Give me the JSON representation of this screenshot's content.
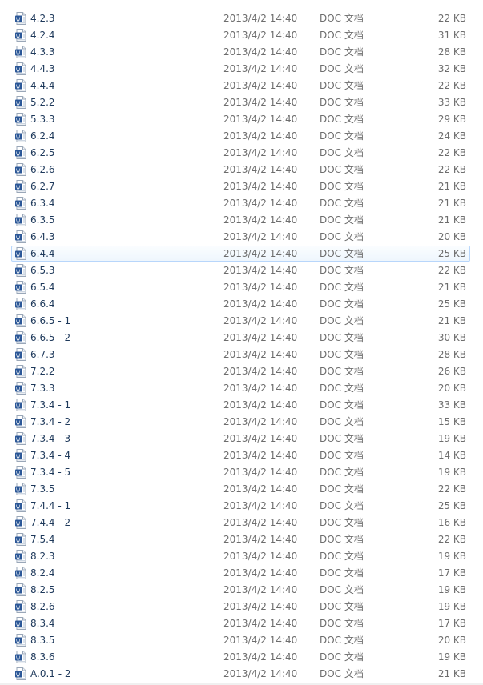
{
  "list": {
    "selected_index": 14,
    "icon": "word-document-icon",
    "colors": {
      "name_text": "#1e395b",
      "meta_text": "#6d6d6d",
      "selection_border": "#b8d6fb",
      "icon_blue": "#2b5797"
    },
    "rows": [
      {
        "name": "4.2.3",
        "date": "2013/4/2 14:40",
        "type": "DOC 文档",
        "size": "22 KB"
      },
      {
        "name": "4.2.4",
        "date": "2013/4/2 14:40",
        "type": "DOC 文档",
        "size": "31 KB"
      },
      {
        "name": "4.3.3",
        "date": "2013/4/2 14:40",
        "type": "DOC 文档",
        "size": "28 KB"
      },
      {
        "name": "4.4.3",
        "date": "2013/4/2 14:40",
        "type": "DOC 文档",
        "size": "32 KB"
      },
      {
        "name": "4.4.4",
        "date": "2013/4/2 14:40",
        "type": "DOC 文档",
        "size": "22 KB"
      },
      {
        "name": "5.2.2",
        "date": "2013/4/2 14:40",
        "type": "DOC 文档",
        "size": "33 KB"
      },
      {
        "name": "5.3.3",
        "date": "2013/4/2 14:40",
        "type": "DOC 文档",
        "size": "29 KB"
      },
      {
        "name": "6.2.4",
        "date": "2013/4/2 14:40",
        "type": "DOC 文档",
        "size": "24 KB"
      },
      {
        "name": "6.2.5",
        "date": "2013/4/2 14:40",
        "type": "DOC 文档",
        "size": "22 KB"
      },
      {
        "name": "6.2.6",
        "date": "2013/4/2 14:40",
        "type": "DOC 文档",
        "size": "22 KB"
      },
      {
        "name": "6.2.7",
        "date": "2013/4/2 14:40",
        "type": "DOC 文档",
        "size": "21 KB"
      },
      {
        "name": "6.3.4",
        "date": "2013/4/2 14:40",
        "type": "DOC 文档",
        "size": "21 KB"
      },
      {
        "name": "6.3.5",
        "date": "2013/4/2 14:40",
        "type": "DOC 文档",
        "size": "21 KB"
      },
      {
        "name": "6.4.3",
        "date": "2013/4/2 14:40",
        "type": "DOC 文档",
        "size": "20 KB"
      },
      {
        "name": "6.4.4",
        "date": "2013/4/2 14:40",
        "type": "DOC 文档",
        "size": "25 KB"
      },
      {
        "name": "6.5.3",
        "date": "2013/4/2 14:40",
        "type": "DOC 文档",
        "size": "22 KB"
      },
      {
        "name": "6.5.4",
        "date": "2013/4/2 14:40",
        "type": "DOC 文档",
        "size": "21 KB"
      },
      {
        "name": "6.6.4",
        "date": "2013/4/2 14:40",
        "type": "DOC 文档",
        "size": "25 KB"
      },
      {
        "name": "6.6.5 - 1",
        "date": "2013/4/2 14:40",
        "type": "DOC 文档",
        "size": "21 KB"
      },
      {
        "name": "6.6.5 - 2",
        "date": "2013/4/2 14:40",
        "type": "DOC 文档",
        "size": "30 KB"
      },
      {
        "name": "6.7.3",
        "date": "2013/4/2 14:40",
        "type": "DOC 文档",
        "size": "28 KB"
      },
      {
        "name": "7.2.2",
        "date": "2013/4/2 14:40",
        "type": "DOC 文档",
        "size": "26 KB"
      },
      {
        "name": "7.3.3",
        "date": "2013/4/2 14:40",
        "type": "DOC 文档",
        "size": "20 KB"
      },
      {
        "name": "7.3.4 - 1",
        "date": "2013/4/2 14:40",
        "type": "DOC 文档",
        "size": "33 KB"
      },
      {
        "name": "7.3.4 - 2",
        "date": "2013/4/2 14:40",
        "type": "DOC 文档",
        "size": "15 KB"
      },
      {
        "name": "7.3.4 - 3",
        "date": "2013/4/2 14:40",
        "type": "DOC 文档",
        "size": "19 KB"
      },
      {
        "name": "7.3.4 - 4",
        "date": "2013/4/2 14:40",
        "type": "DOC 文档",
        "size": "14 KB"
      },
      {
        "name": "7.3.4 - 5",
        "date": "2013/4/2 14:40",
        "type": "DOC 文档",
        "size": "19 KB"
      },
      {
        "name": "7.3.5",
        "date": "2013/4/2 14:40",
        "type": "DOC 文档",
        "size": "22 KB"
      },
      {
        "name": "7.4.4 - 1",
        "date": "2013/4/2 14:40",
        "type": "DOC 文档",
        "size": "25 KB"
      },
      {
        "name": "7.4.4 - 2",
        "date": "2013/4/2 14:40",
        "type": "DOC 文档",
        "size": "16 KB"
      },
      {
        "name": "7.5.4",
        "date": "2013/4/2 14:40",
        "type": "DOC 文档",
        "size": "22 KB"
      },
      {
        "name": "8.2.3",
        "date": "2013/4/2 14:40",
        "type": "DOC 文档",
        "size": "19 KB"
      },
      {
        "name": "8.2.4",
        "date": "2013/4/2 14:40",
        "type": "DOC 文档",
        "size": "17 KB"
      },
      {
        "name": "8.2.5",
        "date": "2013/4/2 14:40",
        "type": "DOC 文档",
        "size": "19 KB"
      },
      {
        "name": "8.2.6",
        "date": "2013/4/2 14:40",
        "type": "DOC 文档",
        "size": "19 KB"
      },
      {
        "name": "8.3.4",
        "date": "2013/4/2 14:40",
        "type": "DOC 文档",
        "size": "17 KB"
      },
      {
        "name": "8.3.5",
        "date": "2013/4/2 14:40",
        "type": "DOC 文档",
        "size": "20 KB"
      },
      {
        "name": "8.3.6",
        "date": "2013/4/2 14:40",
        "type": "DOC 文档",
        "size": "19 KB"
      },
      {
        "name": "A.0.1 - 2",
        "date": "2013/4/2 14:40",
        "type": "DOC 文档",
        "size": "21 KB"
      }
    ]
  }
}
